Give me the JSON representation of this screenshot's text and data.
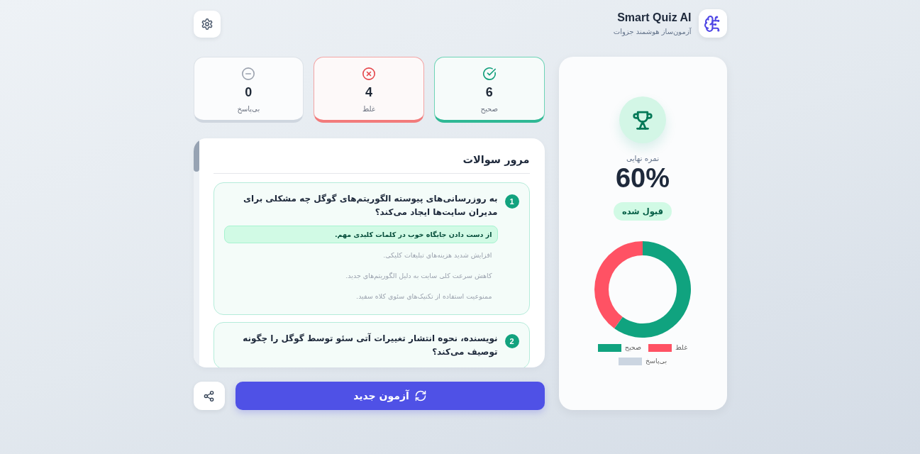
{
  "header": {
    "title": "Smart Quiz AI",
    "subtitle": "آزمون‌ساز هوشمند جزوات"
  },
  "stats": [
    {
      "kind": "correct",
      "value": "6",
      "label": "صحیح"
    },
    {
      "kind": "wrong",
      "value": "4",
      "label": "غلط"
    },
    {
      "kind": "unanswered",
      "value": "0",
      "label": "بی‌پاسخ"
    }
  ],
  "review": {
    "title": "مرور سوالات",
    "questions": [
      {
        "number": "1",
        "correct": true,
        "text": "به روزرسانی‌های پیوسته الگوریتم‌های گوگل چه مشکلی برای مدیران سایت‌ها ایجاد می‌کند؟",
        "options": [
          {
            "text": "از دست دادن جایگاه خوب در کلمات کلیدی مهم.",
            "correct": true
          },
          {
            "text": "افزایش شدید هزینه‌های تبلیغات کلیکی.",
            "correct": false
          },
          {
            "text": "کاهش سرعت کلی سایت به دلیل الگوریتم‌های جدید.",
            "correct": false
          },
          {
            "text": "ممنوعیت استفاده از تکنیک‌های سئوی کلاه سفید.",
            "correct": false
          }
        ]
      },
      {
        "number": "2",
        "correct": true,
        "text": "نویسنده، نحوه انتشار تغییرات آتی سئو توسط گوگل را چگونه توصیف می‌کند؟"
      }
    ]
  },
  "actions": {
    "new_quiz_label": "آزمون جدید"
  },
  "score": {
    "label": "نمره نهایی",
    "value": "60%",
    "passed": true,
    "status": "قبول شده",
    "chart_data": {
      "type": "donut",
      "categories": [
        "صحیح",
        "غلط",
        "بی‌پاسخ"
      ],
      "values": [
        60,
        40,
        0
      ],
      "colors": [
        "#10a37f",
        "#ff5264",
        "#cbd5e1"
      ]
    }
  }
}
